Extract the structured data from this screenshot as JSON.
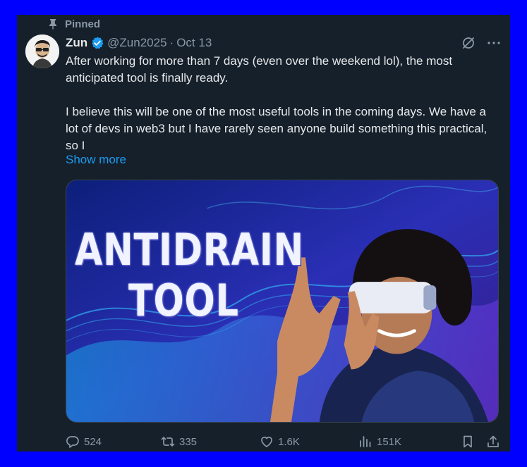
{
  "pinned_label": "Pinned",
  "author": {
    "name": "Zun",
    "handle": "@Zun2025",
    "separator": "·",
    "date": "Oct 13"
  },
  "post": {
    "text": "After working for more than 7 days (even over the weekend lol), the most anticipated tool is finally ready.\n\nI believe this will be one of the most useful tools in the coming days. We have a lot of devs in web3 but I have rarely seen anyone build something this practical, so I",
    "show_more": "Show more"
  },
  "media": {
    "title_line1": "ANTIDRAIN",
    "title_line2": "TOOL"
  },
  "actions": {
    "replies": "524",
    "reposts": "335",
    "likes": "1.6K",
    "views": "151K"
  },
  "colors": {
    "page_bg": "#0000ff",
    "card_bg": "#15202b",
    "accent": "#1d9bf0",
    "muted": "#8b98a5"
  },
  "icons": [
    "pin-icon",
    "verified-badge-icon",
    "grok-icon",
    "more-icon",
    "reply-icon",
    "repost-icon",
    "like-icon",
    "views-icon",
    "bookmark-icon",
    "share-icon"
  ]
}
